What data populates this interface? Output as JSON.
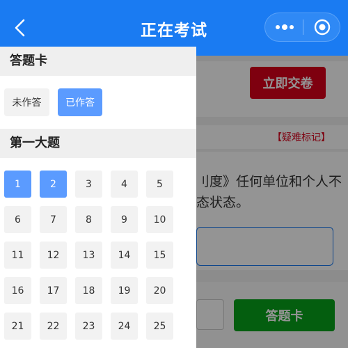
{
  "header": {
    "title": "正在考试",
    "icons": {
      "back": "chevron-left-icon",
      "more": "more-dots-icon",
      "close": "target-circle-icon"
    }
  },
  "background": {
    "submit_label": "立即交卷",
    "flag_label": "【疑难标记】",
    "question_lines": [
      "刂度》任何单位和个人不",
      "态状态。"
    ],
    "answer_sheet_label": "答题卡"
  },
  "drawer": {
    "title": "答题卡",
    "legend": {
      "unanswered": "未作答",
      "answered": "已作答"
    },
    "section_title": "第一大题",
    "questions": [
      {
        "n": "1",
        "answered": true
      },
      {
        "n": "2",
        "answered": true
      },
      {
        "n": "3",
        "answered": false
      },
      {
        "n": "4",
        "answered": false
      },
      {
        "n": "5",
        "answered": false
      },
      {
        "n": "6",
        "answered": false
      },
      {
        "n": "7",
        "answered": false
      },
      {
        "n": "8",
        "answered": false
      },
      {
        "n": "9",
        "answered": false
      },
      {
        "n": "10",
        "answered": false
      },
      {
        "n": "11",
        "answered": false
      },
      {
        "n": "12",
        "answered": false
      },
      {
        "n": "13",
        "answered": false
      },
      {
        "n": "14",
        "answered": false
      },
      {
        "n": "15",
        "answered": false
      },
      {
        "n": "16",
        "answered": false
      },
      {
        "n": "17",
        "answered": false
      },
      {
        "n": "18",
        "answered": false
      },
      {
        "n": "19",
        "answered": false
      },
      {
        "n": "20",
        "answered": false
      },
      {
        "n": "21",
        "answered": false
      },
      {
        "n": "22",
        "answered": false
      },
      {
        "n": "23",
        "answered": false
      },
      {
        "n": "24",
        "answered": false
      },
      {
        "n": "25",
        "answered": false
      }
    ]
  },
  "colors": {
    "header_bg": "#1a7bf2",
    "answered": "#5b9bff",
    "submit_red": "#d9001b",
    "sheet_green": "#07a31b"
  }
}
